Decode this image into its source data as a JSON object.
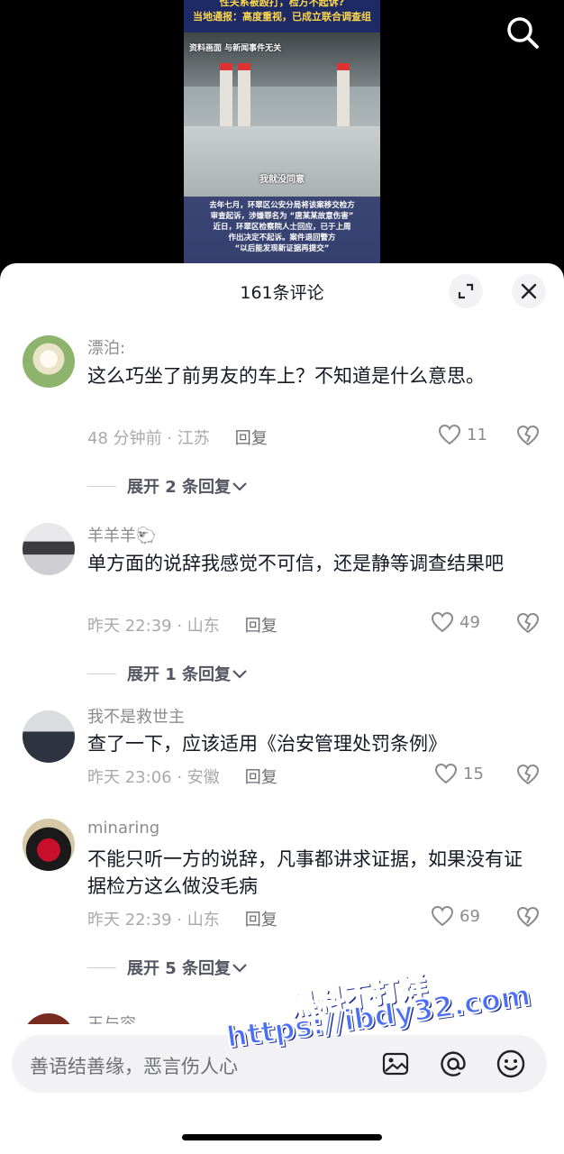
{
  "video": {
    "header_line1": "性关系被殴打，检方不起诉?",
    "header_line2": "当地通报：高度重视，已成立联合调查组",
    "disclaimer": "资料画面 与新闻事件无关",
    "caption": "我就没同意",
    "subtitle_lines": [
      "去年七月，环翠区公安分局将该案移交检方",
      "审查起诉，涉嫌罪名为 “唐某某故意伤害”",
      "近日，环翠区检察院人士回应，已于上周",
      "作出决定不起诉。案件退回警方",
      "“以后能发现新证据再提交”"
    ]
  },
  "sheet": {
    "title": "161条评论"
  },
  "comments": [
    {
      "username": "漂泊:",
      "text": "这么巧坐了前男友的车上？不知道是什么意思。",
      "time_location": "48 分钟前 · 江苏",
      "reply_label": "回复",
      "likes": "11",
      "expand_replies": "展开 2 条回复"
    },
    {
      "username": "羊羊羊🐑",
      "text": "单方面的说辞我感觉不可信，还是静等调查结果吧",
      "time_location": "昨天 22:39 · 山东",
      "reply_label": "回复",
      "likes": "49",
      "expand_replies": "展开 1 条回复"
    },
    {
      "username": "我不是救世主",
      "text": "查了一下，应该适用《治安管理处罚条例》",
      "time_location": "昨天 23:06 · 安徽",
      "reply_label": "回复",
      "likes": "15",
      "expand_replies": ""
    },
    {
      "username": "minaring",
      "text": "不能只听一方的说辞，凡事都讲求证据，如果没有证据检方这么做没毛病",
      "time_location": "昨天 22:39 · 山东",
      "reply_label": "回复",
      "likes": "69",
      "expand_replies": "展开 5 条回复"
    }
  ],
  "partial_next_username": "王与容",
  "watermark": {
    "line1": "黑料不打烊",
    "line2": "https://ibdy32.com"
  },
  "input": {
    "placeholder": "善语结善缘，恶言伤人心"
  },
  "icons": {
    "search": "search-icon",
    "expand": "expand-icon",
    "close": "close-icon",
    "like": "heart-icon",
    "dislike": "broken-heart-icon",
    "chevron": "chevron-down-icon",
    "image": "image-icon",
    "mention": "at-icon",
    "emoji": "emoji-icon"
  }
}
